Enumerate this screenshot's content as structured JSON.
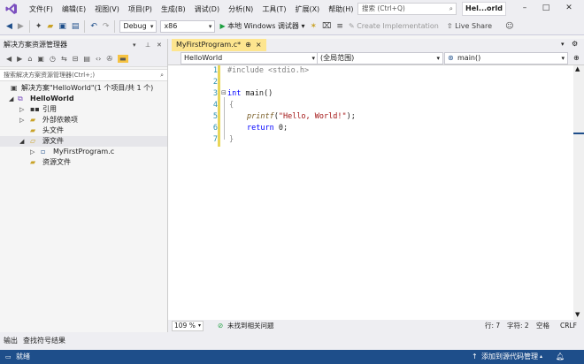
{
  "menubar": {
    "items": [
      "文件(F)",
      "编辑(E)",
      "视图(V)",
      "项目(P)",
      "生成(B)",
      "调试(D)",
      "分析(N)",
      "工具(T)",
      "扩展(X)",
      "帮助(H)"
    ],
    "search_placeholder": "搜索 (Ctrl+Q)",
    "solution_title": "Hel...orld"
  },
  "toolbar": {
    "config": "Debug",
    "platform": "x86",
    "run_label": "本地 Windows 调试器",
    "create_impl": "Create Implementation",
    "live_share": "Live Share"
  },
  "solution_explorer": {
    "title": "解决方案资源管理器",
    "search_placeholder": "搜索解决方案资源管理器(Ctrl+;)",
    "tree": {
      "solution": "解决方案\"HelloWorld\"(1 个项目/共 1 个)",
      "project": "HelloWorld",
      "references": "引用",
      "external_deps": "外部依赖项",
      "header_files": "头文件",
      "source_files": "源文件",
      "source_file": "MyFirstProgram.c",
      "resource_files": "资源文件"
    }
  },
  "editor": {
    "tab_label": "MyFirstProgram.c*",
    "tab_pin": "⊕",
    "tab_close": "×",
    "nav_project": "HelloWorld",
    "nav_scope": "(全局范围)",
    "nav_member": "main()",
    "line_numbers": [
      "1",
      "2",
      "3",
      "4",
      "5",
      "6",
      "7"
    ],
    "code": {
      "l1_directive": "#include <stdio.h>",
      "l3_type": "int",
      "l3_rest": " main()",
      "l4": "{",
      "l5_fn": "printf",
      "l5_open": "(",
      "l5_str": "\"Hello, World!\"",
      "l5_close": ");",
      "l6_kw": "return",
      "l6_rest": " 0;",
      "l7": "}"
    }
  },
  "statusline": {
    "zoom": "109 %",
    "issues": "未找到相关问题",
    "line": "行: 7",
    "col": "字符: 2",
    "whitespace": "空格",
    "eol": "CRLF"
  },
  "bottom_tabs": [
    "输出",
    "查找符号结果"
  ],
  "statusbar": {
    "ready": "就绪",
    "source_control": "添加到源代码管理"
  },
  "colors": {
    "accent": "#1e4e8a",
    "tab_active": "#fde58f",
    "keyword": "#0000ff",
    "string": "#a31515",
    "line_number": "#2b91af"
  }
}
